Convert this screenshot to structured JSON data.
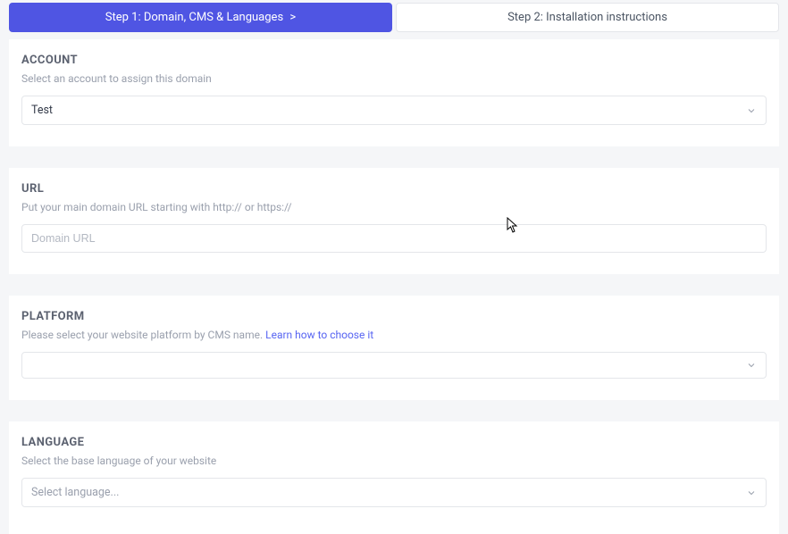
{
  "tabs": {
    "step1": "Step 1: Domain, CMS & Languages",
    "step1_chevron": ">",
    "step2": "Step 2: Installation instructions"
  },
  "account": {
    "title": "ACCOUNT",
    "desc": "Select an account to assign this domain",
    "selected": "Test"
  },
  "url": {
    "title": "URL",
    "desc": "Put your main domain URL starting with http:// or https://",
    "placeholder": "Domain URL",
    "value": ""
  },
  "platform": {
    "title": "PLATFORM",
    "desc_prefix": "Please select your website platform by CMS name.  ",
    "desc_link": "Learn how to choose it",
    "selected": ""
  },
  "language": {
    "title": "LANGUAGE",
    "desc": "Select the base language of your website",
    "selected": "Select language..."
  }
}
